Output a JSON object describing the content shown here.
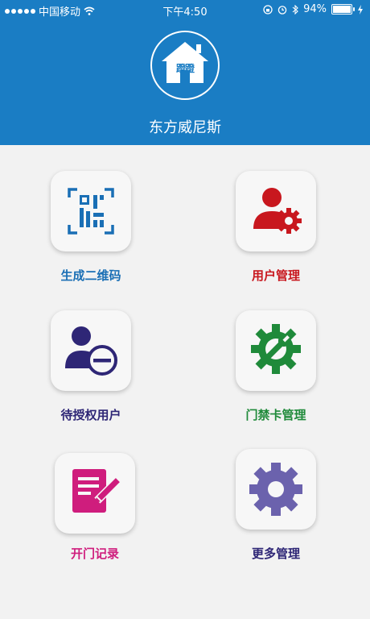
{
  "status_bar": {
    "carrier": "中国移动",
    "time": "下午4:50",
    "battery": "94%",
    "battery_level": 0.94
  },
  "header": {
    "logo_text": "蹬蹬",
    "title": "东方威尼斯"
  },
  "menu": [
    {
      "label": "生成二维码",
      "icon": "qr-code-icon",
      "color": "#1a6fb5"
    },
    {
      "label": "用户管理",
      "icon": "user-gear-icon",
      "color": "#c8171e"
    },
    {
      "label": "待授权用户",
      "icon": "user-minus-icon",
      "color": "#2e2676"
    },
    {
      "label": "门禁卡管理",
      "icon": "wrench-gear-icon",
      "color": "#1f8a3a"
    },
    {
      "label": "开门记录",
      "icon": "edit-record-icon",
      "color": "#cf1d7d"
    },
    {
      "label": "更多管理",
      "icon": "gear-icon",
      "color": "#2e2676"
    }
  ],
  "colors": {
    "header_bg": "#1a7dc4",
    "page_bg": "#f2f2f2"
  }
}
